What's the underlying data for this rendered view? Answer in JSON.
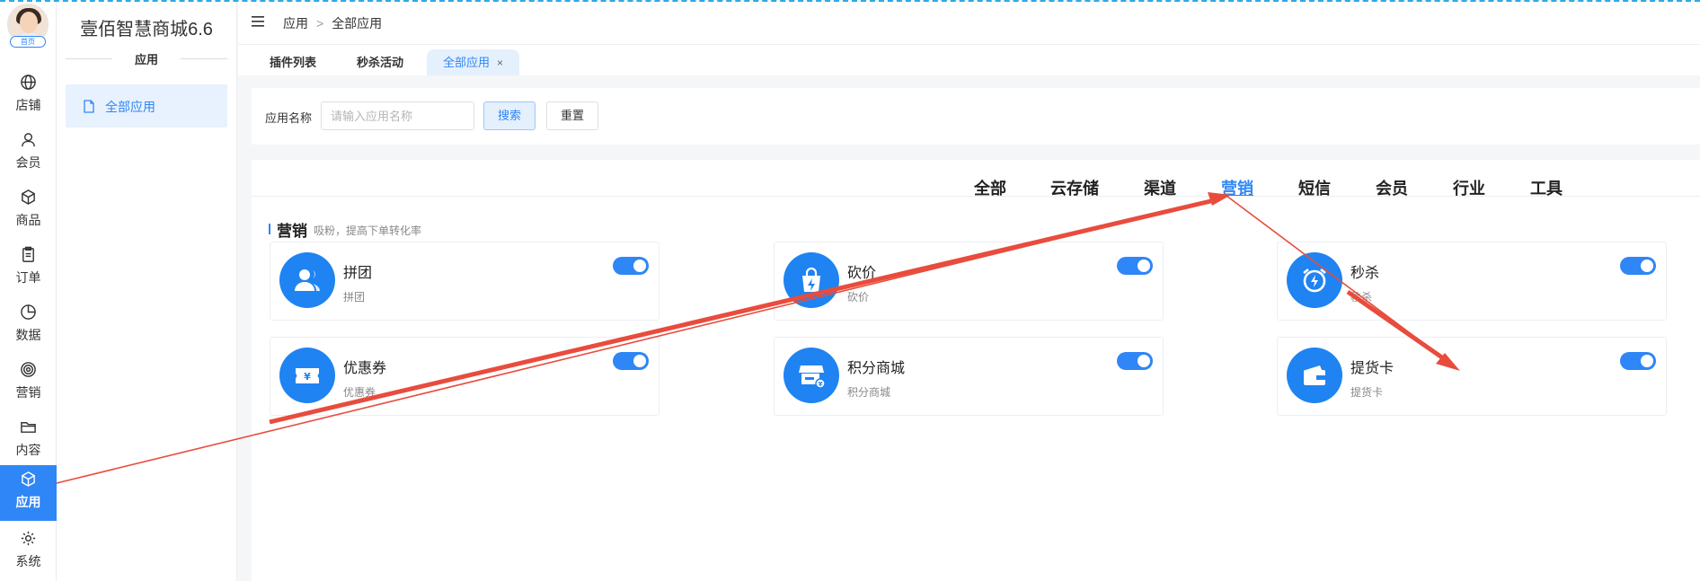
{
  "avatar": {
    "badge": "首页"
  },
  "rail": [
    {
      "label": "店铺",
      "icon": "globe-icon"
    },
    {
      "label": "会员",
      "icon": "user-icon"
    },
    {
      "label": "商品",
      "icon": "cube-icon"
    },
    {
      "label": "订单",
      "icon": "clipboard-icon"
    },
    {
      "label": "数据",
      "icon": "pie-chart-icon"
    },
    {
      "label": "营销",
      "icon": "target-icon"
    },
    {
      "label": "内容",
      "icon": "folder-icon"
    },
    {
      "label": "应用",
      "icon": "box-icon",
      "active": true
    },
    {
      "label": "系统",
      "icon": "gear-icon"
    }
  ],
  "sidebar": {
    "title": "壹佰智慧商城6.6",
    "group": "应用",
    "items": [
      {
        "label": "全部应用"
      }
    ]
  },
  "header": {
    "breadcrumb": [
      "应用",
      "全部应用"
    ],
    "sep": ">"
  },
  "tabs": [
    {
      "label": "插件列表"
    },
    {
      "label": "秒杀活动"
    },
    {
      "label": "全部应用",
      "active": true,
      "close": "×"
    }
  ],
  "search": {
    "label": "应用名称",
    "placeholder": "请输入应用名称",
    "search_btn": "搜索",
    "reset_btn": "重置"
  },
  "categories": [
    "全部",
    "云存储",
    "渠道",
    "营销",
    "短信",
    "会员",
    "行业",
    "工具"
  ],
  "active_category": "营销",
  "section": {
    "title": "营销",
    "subtitle": "吸粉，提高下单转化率"
  },
  "apps": [
    {
      "name": "拼团",
      "desc": "拼团",
      "icon": "group-users-icon",
      "enabled": true
    },
    {
      "name": "砍价",
      "desc": "砍价",
      "icon": "shopping-bag-bolt-icon",
      "enabled": true
    },
    {
      "name": "秒杀",
      "desc": "秒杀",
      "icon": "alarm-clock-bolt-icon",
      "enabled": true
    },
    {
      "name": "优惠券",
      "desc": "优惠券",
      "icon": "coupon-yen-icon",
      "enabled": true
    },
    {
      "name": "积分商城",
      "desc": "积分商城",
      "icon": "store-coin-icon",
      "enabled": true
    },
    {
      "name": "提货卡",
      "desc": "提货卡",
      "icon": "wallet-card-icon",
      "enabled": true
    }
  ],
  "colors": {
    "accent": "#2f86f6",
    "annotation": "#e84c3d"
  }
}
